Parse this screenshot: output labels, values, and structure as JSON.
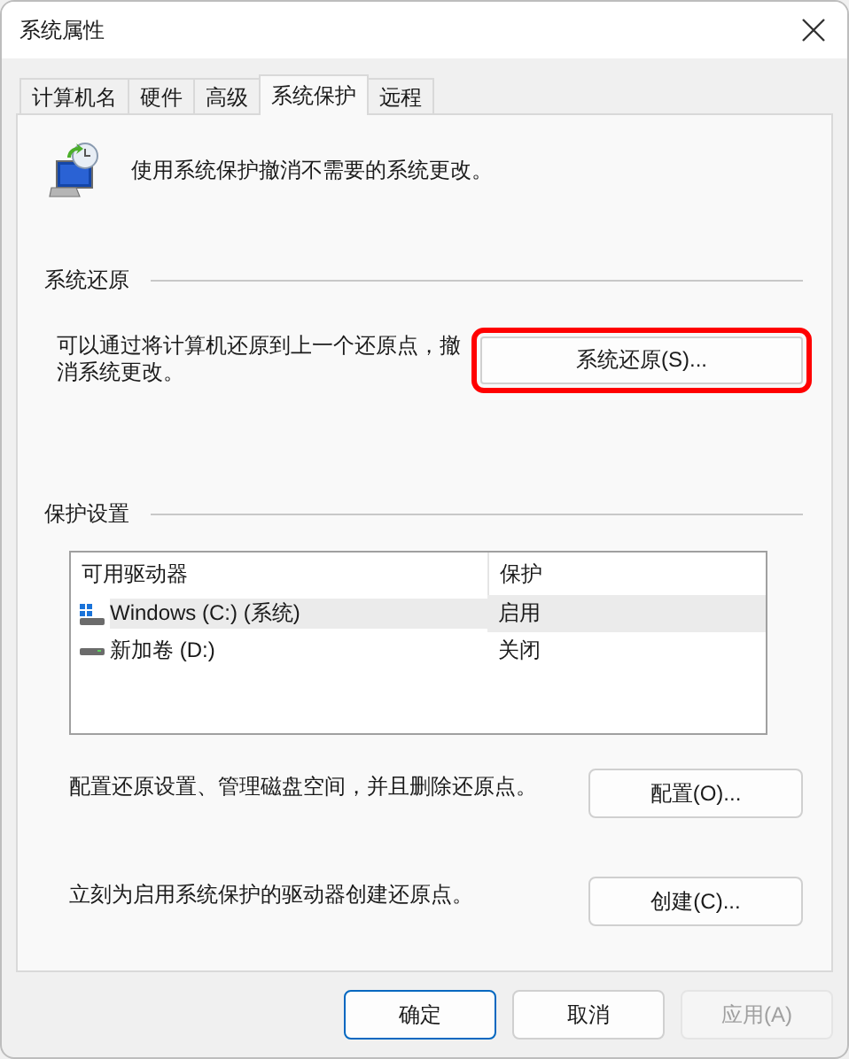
{
  "window": {
    "title": "系统属性"
  },
  "tabs": [
    {
      "label": "计算机名",
      "selected": false
    },
    {
      "label": "硬件",
      "selected": false
    },
    {
      "label": "高级",
      "selected": false
    },
    {
      "label": "系统保护",
      "selected": true
    },
    {
      "label": "远程",
      "selected": false
    }
  ],
  "intro": "使用系统保护撤消不需要的系统更改。",
  "restore_group": {
    "title": "系统还原",
    "text": "可以通过将计算机还原到上一个还原点，撤消系统更改。",
    "button": {
      "label": "系统还原(S)...",
      "highlighted": true
    }
  },
  "protection_group": {
    "title": "保护设置",
    "table": {
      "columns": [
        "可用驱动器",
        "保护"
      ],
      "rows": [
        {
          "kind": "system",
          "drive": "Windows (C:) (系统)",
          "protection": "启用",
          "selected": true
        },
        {
          "kind": "drive",
          "drive": "新加卷 (D:)",
          "protection": "关闭",
          "selected": false
        }
      ]
    },
    "actions": [
      {
        "text": "配置还原设置、管理磁盘空间，并且删除还原点。",
        "button": "配置(O)..."
      },
      {
        "text": "立刻为启用系统保护的驱动器创建还原点。",
        "button": "创建(C)..."
      }
    ]
  },
  "buttons": [
    {
      "label": "确定",
      "kind": "default",
      "disabled": false
    },
    {
      "label": "取消",
      "kind": "normal",
      "disabled": false
    },
    {
      "label": "应用(A)",
      "kind": "normal",
      "disabled": true
    }
  ]
}
